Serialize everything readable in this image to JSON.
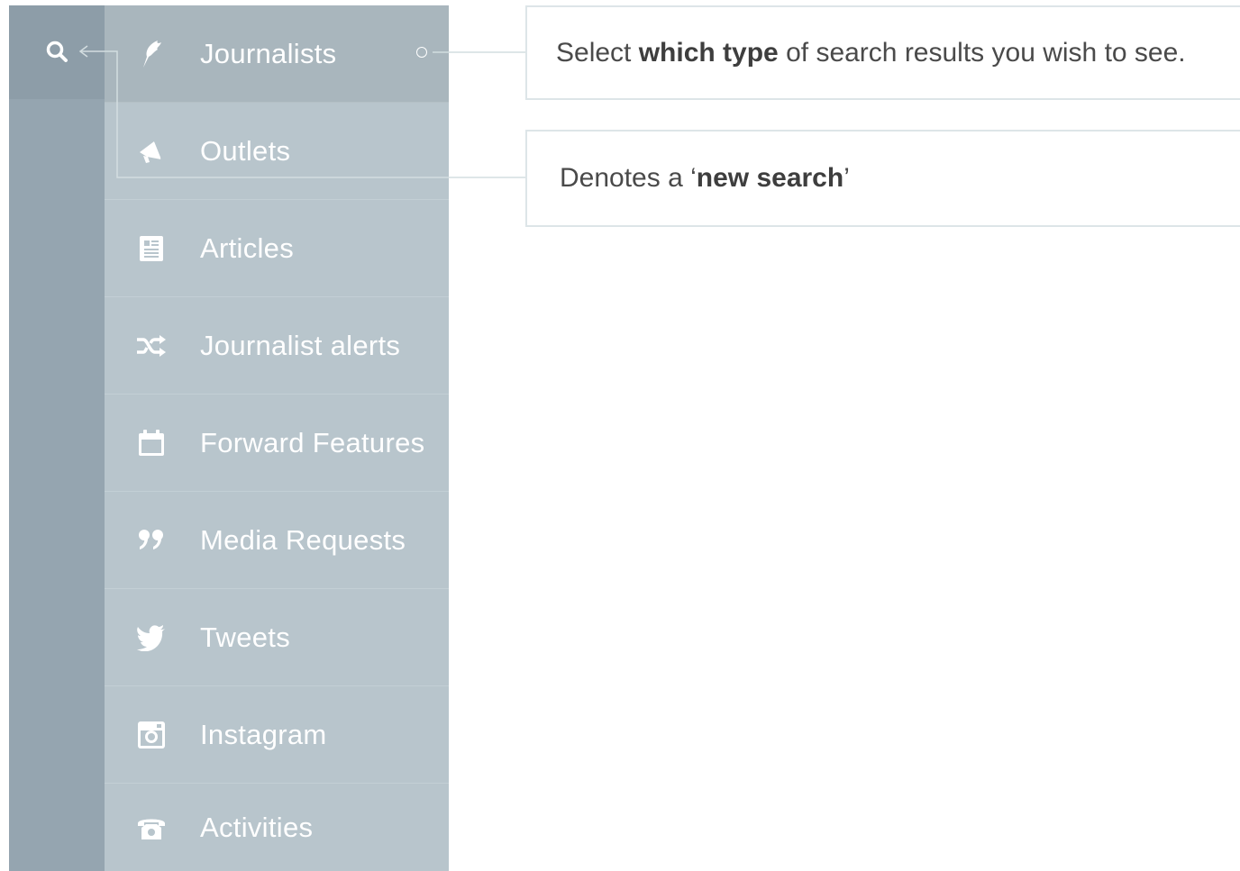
{
  "nav": {
    "search_icon": "search-icon",
    "items": [
      {
        "label": "Journalists",
        "icon": "quill-icon",
        "active": true
      },
      {
        "label": "Outlets",
        "icon": "megaphone-icon"
      },
      {
        "label": "Articles",
        "icon": "article-icon"
      },
      {
        "label": "Journalist alerts",
        "icon": "shuffle-icon"
      },
      {
        "label": "Forward Features",
        "icon": "calendar-icon"
      },
      {
        "label": "Media Requests",
        "icon": "quote-icon"
      },
      {
        "label": "Tweets",
        "icon": "twitter-icon"
      },
      {
        "label": "Instagram",
        "icon": "instagram-icon"
      },
      {
        "label": "Activities",
        "icon": "phone-icon"
      }
    ]
  },
  "callouts": {
    "type_select": {
      "pre": "Select ",
      "bold": "which type",
      "post": " of search results you wish to see."
    },
    "new_search": {
      "pre": "Denotes a ‘",
      "bold": "new search",
      "post": "’"
    }
  },
  "colors": {
    "rail": "#95a5b0",
    "menu": "#b8c5cc",
    "active_item": "#a9b6bd",
    "connector": "#d3dde0",
    "callout_border": "#dde5e8"
  }
}
